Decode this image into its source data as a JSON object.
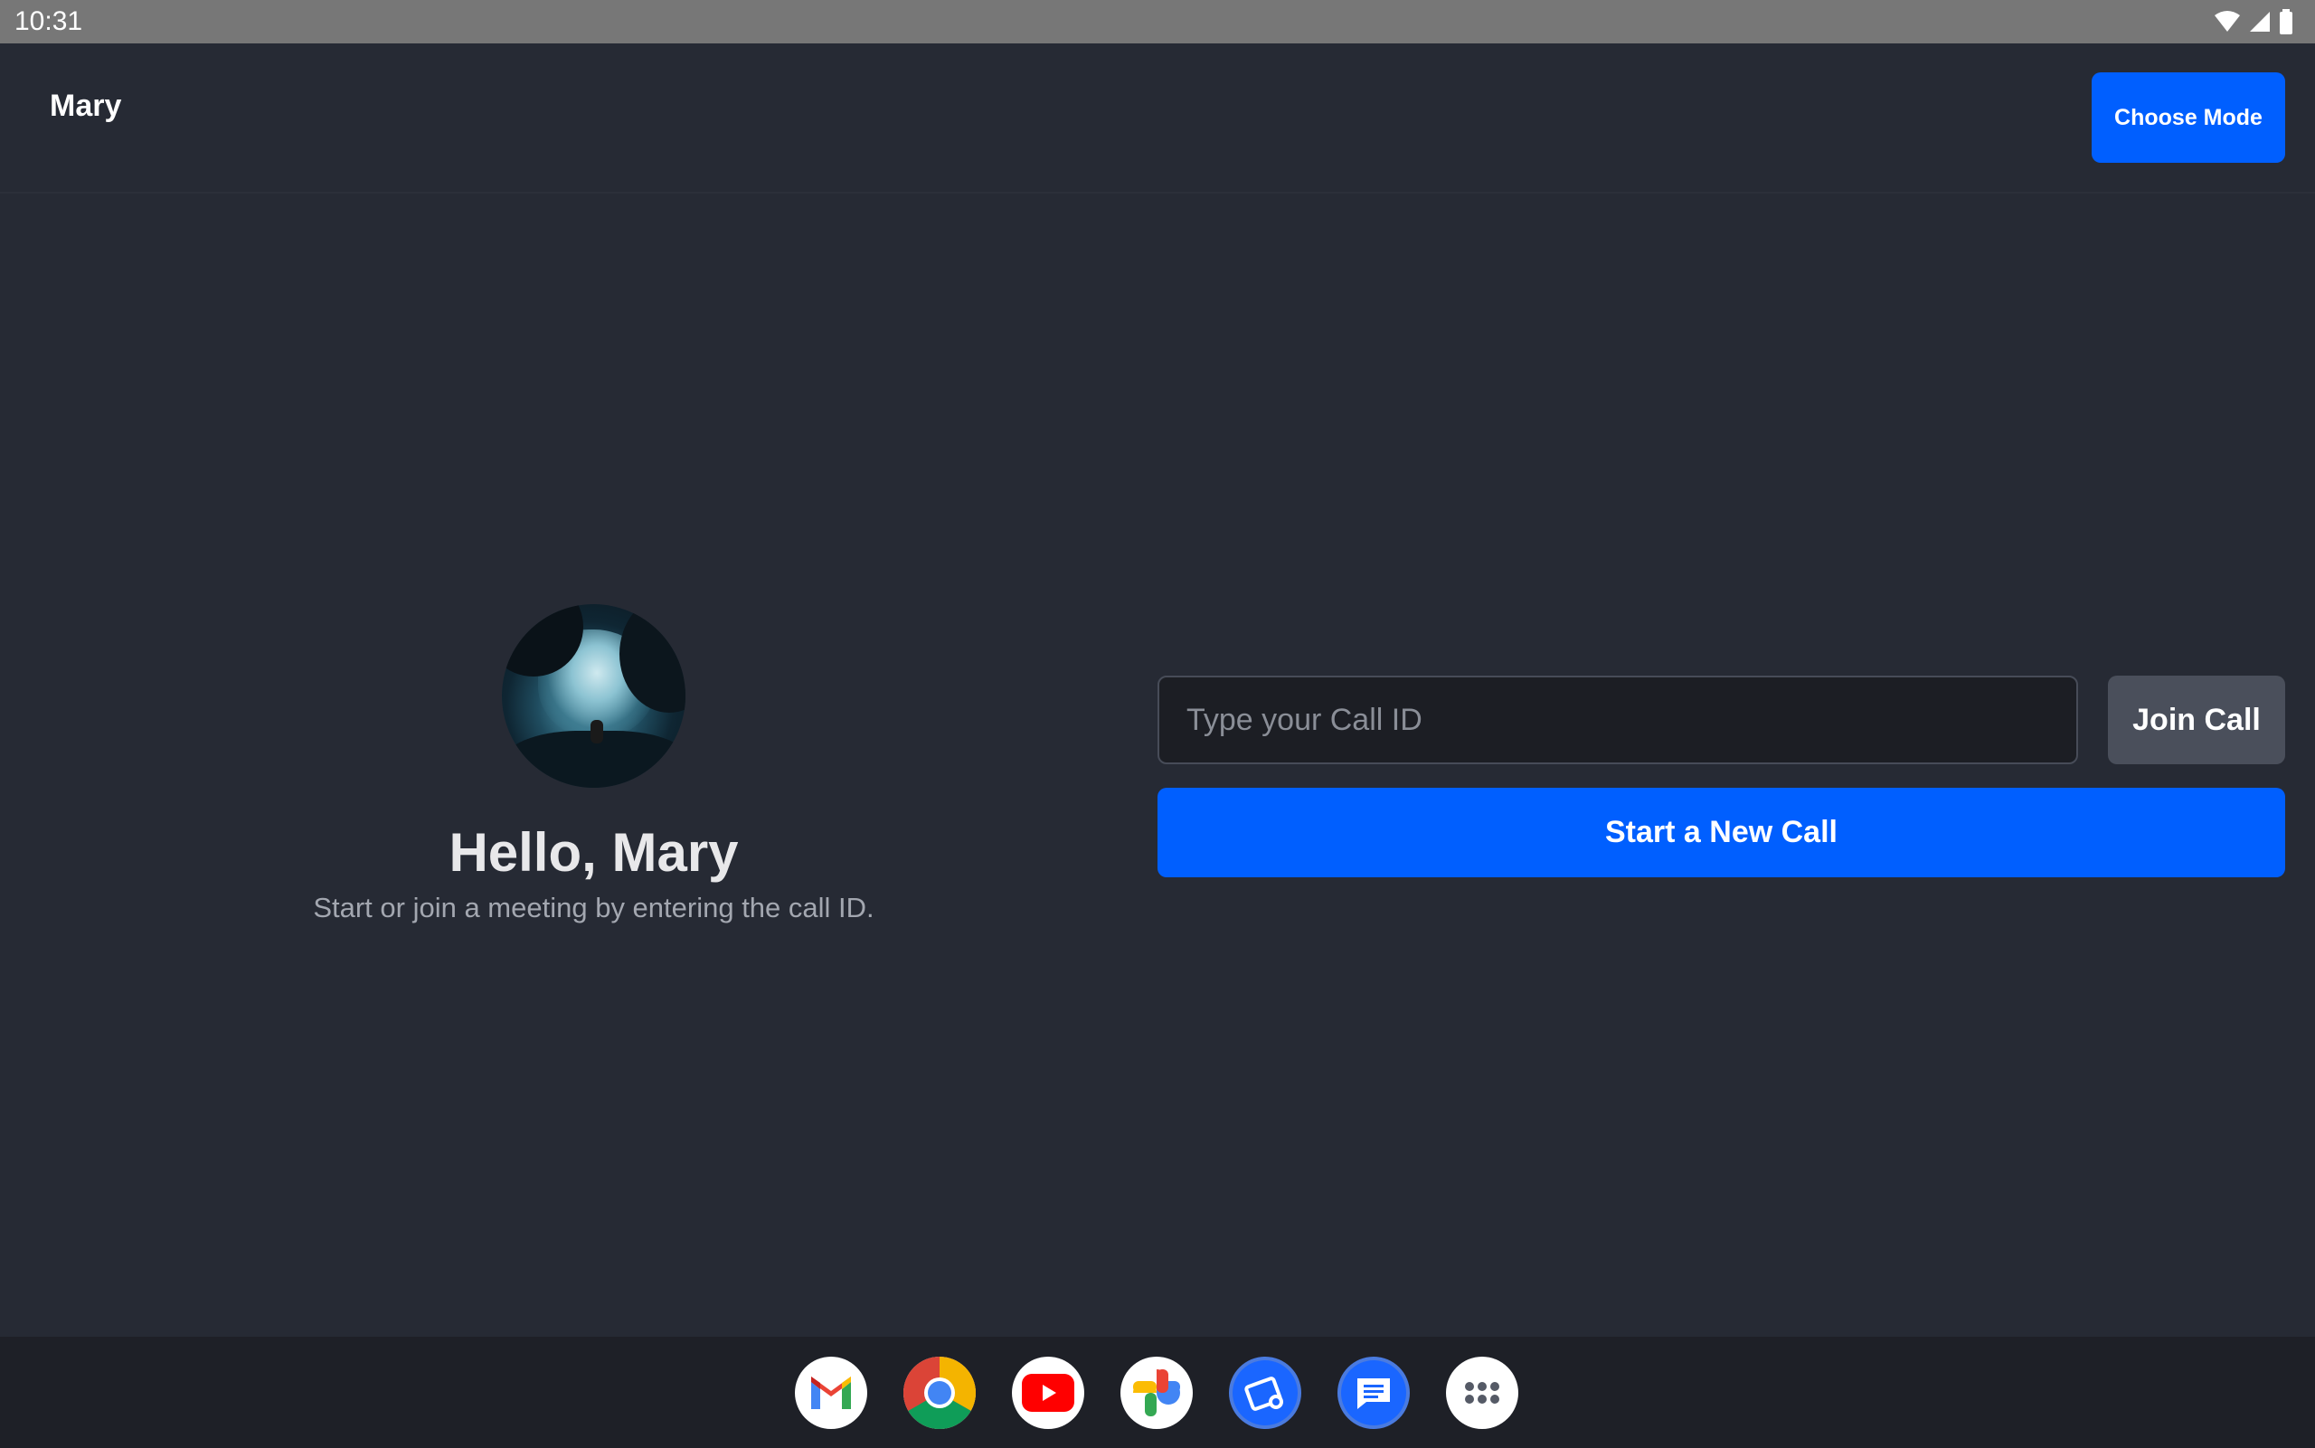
{
  "status_bar": {
    "time": "10:31",
    "icons": [
      "wifi-icon",
      "cell-signal-icon",
      "battery-icon"
    ]
  },
  "app_bar": {
    "user_name": "Mary",
    "choose_mode_label": "Choose Mode"
  },
  "profile": {
    "greeting": "Hello, Mary",
    "subtitle": "Start or join a meeting by entering the call ID."
  },
  "call": {
    "input_placeholder": "Type your Call ID",
    "input_value": "",
    "join_label": "Join Call",
    "start_label": "Start a New Call"
  },
  "dock": {
    "apps": [
      "gmail-icon",
      "chrome-icon",
      "youtube-icon",
      "photos-icon",
      "files-icon",
      "messages-icon",
      "app-drawer-icon"
    ]
  },
  "colors": {
    "background": "#262a34",
    "accent": "#005fff",
    "secondary_button": "#4a4f5b",
    "status_bar": "#777777"
  }
}
